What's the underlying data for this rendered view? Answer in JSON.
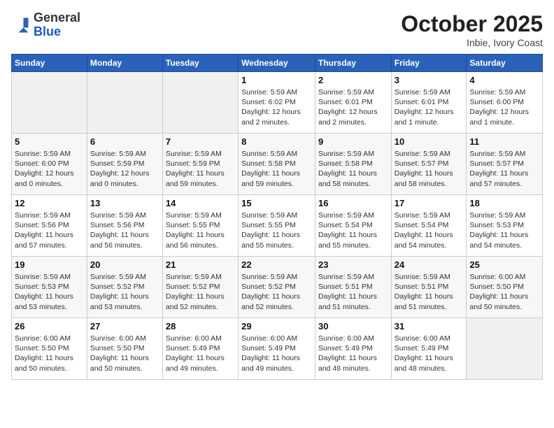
{
  "header": {
    "logo_general": "General",
    "logo_blue": "Blue",
    "month": "October 2025",
    "location": "Inbie, Ivory Coast"
  },
  "weekdays": [
    "Sunday",
    "Monday",
    "Tuesday",
    "Wednesday",
    "Thursday",
    "Friday",
    "Saturday"
  ],
  "weeks": [
    [
      {
        "day": null
      },
      {
        "day": null
      },
      {
        "day": null
      },
      {
        "day": "1",
        "sunrise": "Sunrise: 5:59 AM",
        "sunset": "Sunset: 6:02 PM",
        "daylight": "Daylight: 12 hours and 2 minutes."
      },
      {
        "day": "2",
        "sunrise": "Sunrise: 5:59 AM",
        "sunset": "Sunset: 6:01 PM",
        "daylight": "Daylight: 12 hours and 2 minutes."
      },
      {
        "day": "3",
        "sunrise": "Sunrise: 5:59 AM",
        "sunset": "Sunset: 6:01 PM",
        "daylight": "Daylight: 12 hours and 1 minute."
      },
      {
        "day": "4",
        "sunrise": "Sunrise: 5:59 AM",
        "sunset": "Sunset: 6:00 PM",
        "daylight": "Daylight: 12 hours and 1 minute."
      }
    ],
    [
      {
        "day": "5",
        "sunrise": "Sunrise: 5:59 AM",
        "sunset": "Sunset: 6:00 PM",
        "daylight": "Daylight: 12 hours and 0 minutes."
      },
      {
        "day": "6",
        "sunrise": "Sunrise: 5:59 AM",
        "sunset": "Sunset: 5:59 PM",
        "daylight": "Daylight: 12 hours and 0 minutes."
      },
      {
        "day": "7",
        "sunrise": "Sunrise: 5:59 AM",
        "sunset": "Sunset: 5:59 PM",
        "daylight": "Daylight: 11 hours and 59 minutes."
      },
      {
        "day": "8",
        "sunrise": "Sunrise: 5:59 AM",
        "sunset": "Sunset: 5:58 PM",
        "daylight": "Daylight: 11 hours and 59 minutes."
      },
      {
        "day": "9",
        "sunrise": "Sunrise: 5:59 AM",
        "sunset": "Sunset: 5:58 PM",
        "daylight": "Daylight: 11 hours and 58 minutes."
      },
      {
        "day": "10",
        "sunrise": "Sunrise: 5:59 AM",
        "sunset": "Sunset: 5:57 PM",
        "daylight": "Daylight: 11 hours and 58 minutes."
      },
      {
        "day": "11",
        "sunrise": "Sunrise: 5:59 AM",
        "sunset": "Sunset: 5:57 PM",
        "daylight": "Daylight: 11 hours and 57 minutes."
      }
    ],
    [
      {
        "day": "12",
        "sunrise": "Sunrise: 5:59 AM",
        "sunset": "Sunset: 5:56 PM",
        "daylight": "Daylight: 11 hours and 57 minutes."
      },
      {
        "day": "13",
        "sunrise": "Sunrise: 5:59 AM",
        "sunset": "Sunset: 5:56 PM",
        "daylight": "Daylight: 11 hours and 56 minutes."
      },
      {
        "day": "14",
        "sunrise": "Sunrise: 5:59 AM",
        "sunset": "Sunset: 5:55 PM",
        "daylight": "Daylight: 11 hours and 56 minutes."
      },
      {
        "day": "15",
        "sunrise": "Sunrise: 5:59 AM",
        "sunset": "Sunset: 5:55 PM",
        "daylight": "Daylight: 11 hours and 55 minutes."
      },
      {
        "day": "16",
        "sunrise": "Sunrise: 5:59 AM",
        "sunset": "Sunset: 5:54 PM",
        "daylight": "Daylight: 11 hours and 55 minutes."
      },
      {
        "day": "17",
        "sunrise": "Sunrise: 5:59 AM",
        "sunset": "Sunset: 5:54 PM",
        "daylight": "Daylight: 11 hours and 54 minutes."
      },
      {
        "day": "18",
        "sunrise": "Sunrise: 5:59 AM",
        "sunset": "Sunset: 5:53 PM",
        "daylight": "Daylight: 11 hours and 54 minutes."
      }
    ],
    [
      {
        "day": "19",
        "sunrise": "Sunrise: 5:59 AM",
        "sunset": "Sunset: 5:53 PM",
        "daylight": "Daylight: 11 hours and 53 minutes."
      },
      {
        "day": "20",
        "sunrise": "Sunrise: 5:59 AM",
        "sunset": "Sunset: 5:52 PM",
        "daylight": "Daylight: 11 hours and 53 minutes."
      },
      {
        "day": "21",
        "sunrise": "Sunrise: 5:59 AM",
        "sunset": "Sunset: 5:52 PM",
        "daylight": "Daylight: 11 hours and 52 minutes."
      },
      {
        "day": "22",
        "sunrise": "Sunrise: 5:59 AM",
        "sunset": "Sunset: 5:52 PM",
        "daylight": "Daylight: 11 hours and 52 minutes."
      },
      {
        "day": "23",
        "sunrise": "Sunrise: 5:59 AM",
        "sunset": "Sunset: 5:51 PM",
        "daylight": "Daylight: 11 hours and 51 minutes."
      },
      {
        "day": "24",
        "sunrise": "Sunrise: 5:59 AM",
        "sunset": "Sunset: 5:51 PM",
        "daylight": "Daylight: 11 hours and 51 minutes."
      },
      {
        "day": "25",
        "sunrise": "Sunrise: 6:00 AM",
        "sunset": "Sunset: 5:50 PM",
        "daylight": "Daylight: 11 hours and 50 minutes."
      }
    ],
    [
      {
        "day": "26",
        "sunrise": "Sunrise: 6:00 AM",
        "sunset": "Sunset: 5:50 PM",
        "daylight": "Daylight: 11 hours and 50 minutes."
      },
      {
        "day": "27",
        "sunrise": "Sunrise: 6:00 AM",
        "sunset": "Sunset: 5:50 PM",
        "daylight": "Daylight: 11 hours and 50 minutes."
      },
      {
        "day": "28",
        "sunrise": "Sunrise: 6:00 AM",
        "sunset": "Sunset: 5:49 PM",
        "daylight": "Daylight: 11 hours and 49 minutes."
      },
      {
        "day": "29",
        "sunrise": "Sunrise: 6:00 AM",
        "sunset": "Sunset: 5:49 PM",
        "daylight": "Daylight: 11 hours and 49 minutes."
      },
      {
        "day": "30",
        "sunrise": "Sunrise: 6:00 AM",
        "sunset": "Sunset: 5:49 PM",
        "daylight": "Daylight: 11 hours and 48 minutes."
      },
      {
        "day": "31",
        "sunrise": "Sunrise: 6:00 AM",
        "sunset": "Sunset: 5:49 PM",
        "daylight": "Daylight: 11 hours and 48 minutes."
      },
      {
        "day": null
      }
    ]
  ]
}
